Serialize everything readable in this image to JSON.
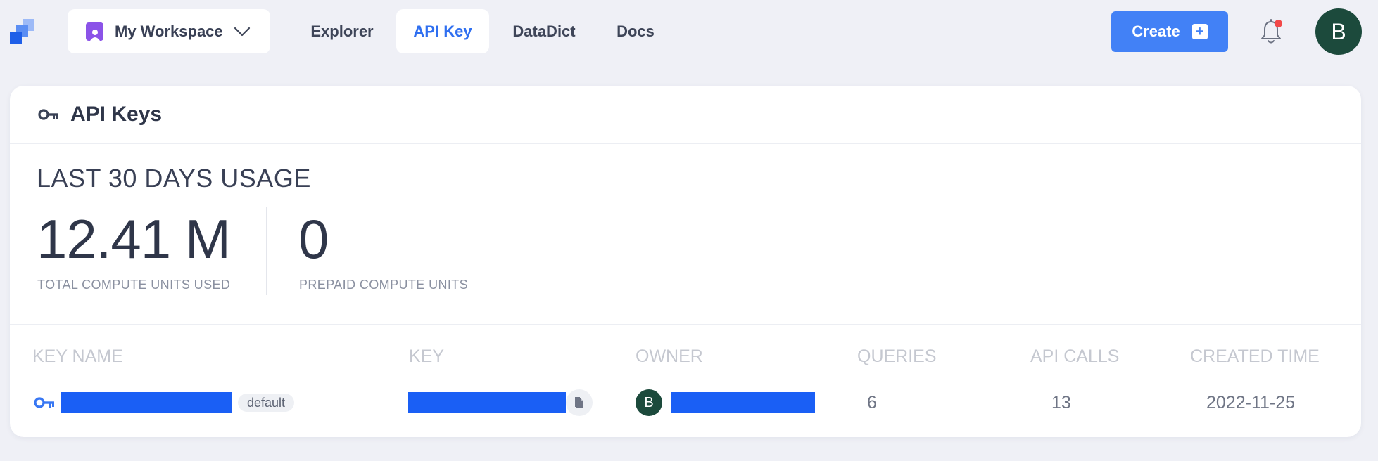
{
  "brand": {
    "accent": "#4281f6",
    "active_tab_color": "#2f6ff0",
    "logo_icon": "stacked-squares-logo-icon"
  },
  "workspace": {
    "label": "My Workspace",
    "icon": "workspace-icon",
    "icon_color": "#8b53e8"
  },
  "nav": {
    "tabs": [
      {
        "label": "Explorer",
        "active": false
      },
      {
        "label": "API Key",
        "active": true
      },
      {
        "label": "DataDict",
        "active": false
      },
      {
        "label": "Docs",
        "active": false
      }
    ]
  },
  "header_actions": {
    "create_label": "Create",
    "create_icon": "plus-square-icon",
    "notification_icon": "bell-icon",
    "has_unread": true,
    "avatar_initial": "B",
    "avatar_color": "#1c4a3c"
  },
  "card": {
    "title": "API Keys",
    "title_icon": "key-icon",
    "usage": {
      "heading": "LAST 30 DAYS USAGE",
      "stats": [
        {
          "value": "12.41 M",
          "label": "TOTAL COMPUTE UNITS USED"
        },
        {
          "value": "0",
          "label": "PREPAID COMPUTE UNITS"
        }
      ]
    },
    "table": {
      "columns": [
        "KEY NAME",
        "KEY",
        "OWNER",
        "QUERIES",
        "API CALLS",
        "CREATED TIME"
      ],
      "rows": [
        {
          "key_name_redacted": true,
          "badge": "default",
          "key_redacted": true,
          "owner_initial": "B",
          "owner_redacted": true,
          "queries": "6",
          "api_calls": "13",
          "created_time": "2022-11-25"
        }
      ]
    }
  }
}
